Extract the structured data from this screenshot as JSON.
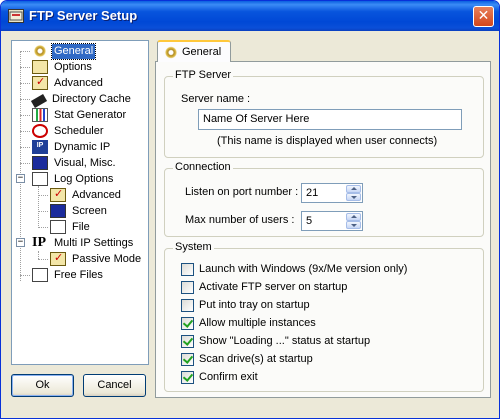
{
  "window": {
    "title": "FTP Server Setup",
    "close_glyph": "✕"
  },
  "tree": {
    "items": [
      {
        "label": "General",
        "icon": "gear-icon"
      },
      {
        "label": "Options",
        "icon": "options-icon"
      },
      {
        "label": "Advanced",
        "icon": "advanced-icon"
      },
      {
        "label": "Directory Cache",
        "icon": "cache-icon"
      },
      {
        "label": "Stat Generator",
        "icon": "stats-icon"
      },
      {
        "label": "Scheduler",
        "icon": "clock-icon"
      },
      {
        "label": "Dynamic IP",
        "icon": "ip-icon"
      },
      {
        "label": "Visual, Misc.",
        "icon": "monitor-icon"
      },
      {
        "label": "Log Options",
        "icon": "log-icon"
      },
      {
        "label": "Advanced",
        "icon": "advanced-icon"
      },
      {
        "label": "Screen",
        "icon": "screen-icon"
      },
      {
        "label": "File",
        "icon": "file-icon"
      },
      {
        "label": "Multi IP Settings",
        "icon": "multi-ip-icon"
      },
      {
        "label": "Passive Mode",
        "icon": "passive-icon"
      },
      {
        "label": "Free Files",
        "icon": "free-files-icon"
      }
    ],
    "selected": "General",
    "collapse_glyph": "−",
    "icon_texts": {
      "ip": "IP",
      "multi_ip": "IP"
    }
  },
  "buttons": {
    "ok": "Ok",
    "cancel": "Cancel"
  },
  "tab": {
    "label": "General"
  },
  "ftp_server": {
    "title": "FTP Server",
    "server_name_label": "Server name :",
    "server_name_value": "Name Of Server Here",
    "hint": "(This name is displayed when user connects)"
  },
  "connection": {
    "title": "Connection",
    "port_label": "Listen on port number :",
    "port_value": "21",
    "max_users_label": "Max number of users :",
    "max_users_value": "5"
  },
  "system": {
    "title": "System",
    "options": [
      {
        "label": "Launch with Windows (9x/Me version only)",
        "checked": false
      },
      {
        "label": "Activate FTP server on startup",
        "checked": false
      },
      {
        "label": "Put into tray on startup",
        "checked": false
      },
      {
        "label": "Allow multiple instances",
        "checked": true
      },
      {
        "label": "Show \"Loading ...\" status at startup",
        "checked": true
      },
      {
        "label": "Scan drive(s) at startup",
        "checked": true
      },
      {
        "label": "Confirm exit",
        "checked": true
      }
    ]
  }
}
